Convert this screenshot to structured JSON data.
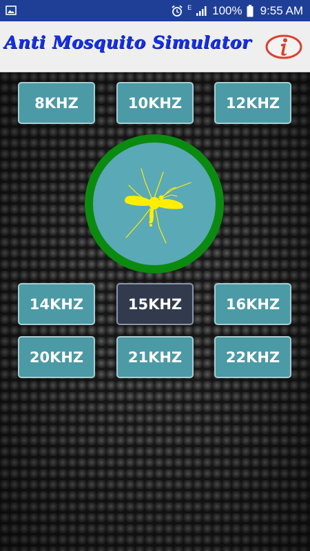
{
  "status_bar": {
    "battery": "100%",
    "time": "9:55 AM",
    "network_letter": "E",
    "icons": [
      "image-icon",
      "alarm-icon",
      "signal-icon",
      "battery-icon"
    ]
  },
  "app_bar": {
    "title": "Anti Mosquito Simulator",
    "info_icon": "info-icon"
  },
  "colors": {
    "status_bar": "#1f3f97",
    "title": "#1430e6",
    "button": "#4b9aa6",
    "button_selected": "#323a4d",
    "ring": "#0b8a10",
    "mosquito": "#ffee00",
    "info_red": "#d9412e"
  },
  "frequency_buttons": {
    "row1": [
      "8KHZ",
      "10KHZ",
      "12KHZ"
    ],
    "row2": [
      "14KHZ",
      "15KHZ",
      "16KHZ"
    ],
    "row3": [
      "20KHZ",
      "21KHZ",
      "22KHZ"
    ],
    "selected": "15KHZ"
  },
  "center": {
    "icon": "mosquito-icon"
  }
}
